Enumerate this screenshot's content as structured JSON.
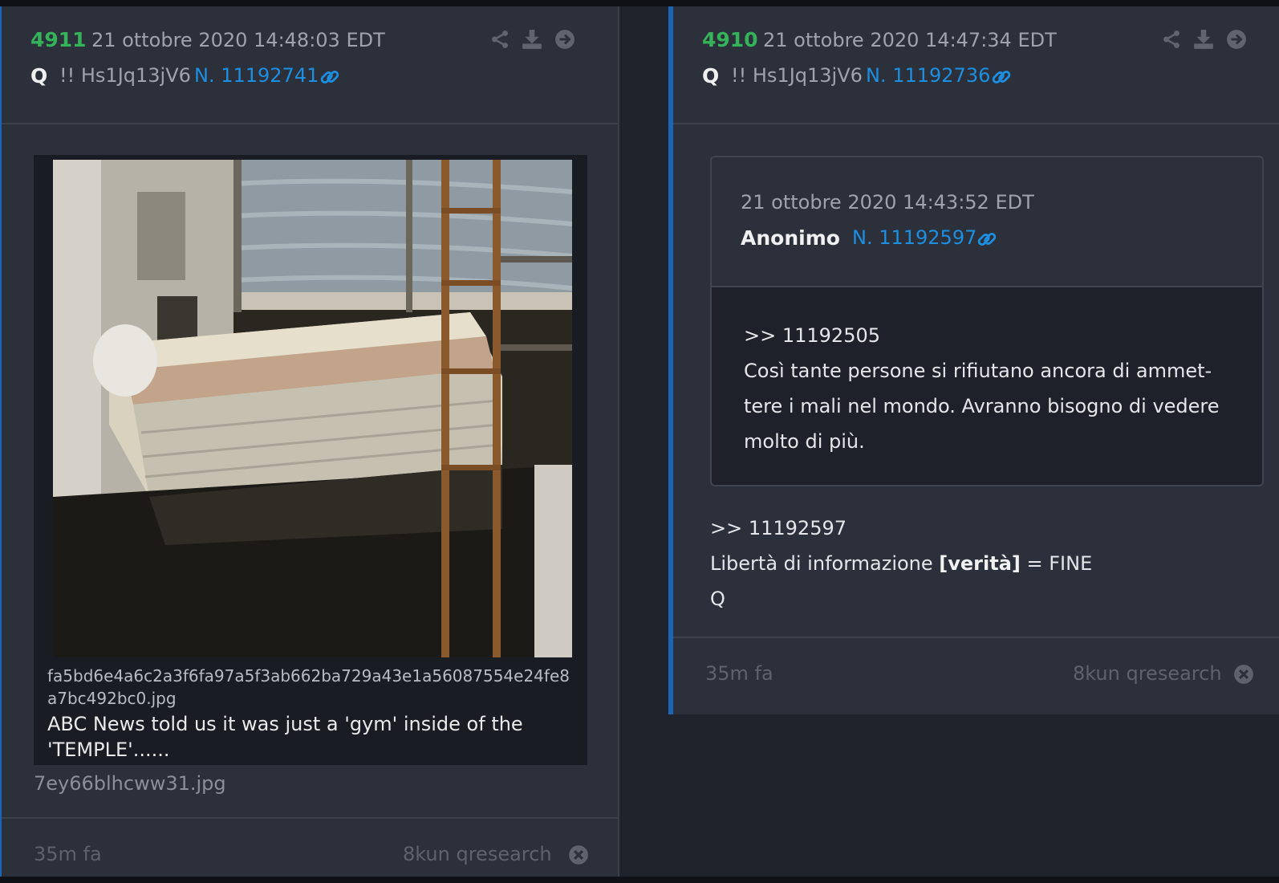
{
  "left_post": {
    "number": "4911",
    "date": "21 ottobre 2020 14:48:03 EDT",
    "author": "Q",
    "tripcode": "!! Hs1Jq13jV6",
    "ref": "N. 11192741",
    "image_hash_name": "fa5bd6e4a6c2a3f6fa97a5f3ab662ba729a43e1a56087554e24fe8a7bc492bc0.jpg",
    "image_caption": "ABC News told us it was just a 'gym' inside of the 'TEMPLE'......",
    "file_name": "7ey66blhcww31.jpg",
    "age": "35m fa",
    "board": "8kun qresearch"
  },
  "right_post": {
    "number": "4910",
    "date": "21 ottobre 2020 14:47:34 EDT",
    "author": "Q",
    "tripcode": "!! Hs1Jq13jV6",
    "ref": "N. 11192736",
    "quoted": {
      "date": "21 ottobre 2020 14:43:52 EDT",
      "author": "Anonimo",
      "ref": "N. 11192597",
      "reply_to": ">> 11192505",
      "lines": [
        "Così tante persone si rifiutano ancora di ammet-",
        "tere i mali nel mondo. Avranno bisogno di vedere",
        "molto di più."
      ]
    },
    "reply_to": ">> 11192597",
    "body_pre": "Libertà di informazione ",
    "body_bold": "[verità]",
    "body_post": " = FINE",
    "signature": "Q",
    "age": "35m fa",
    "board": "8kun qresearch"
  },
  "icons": [
    "share-icon",
    "download-icon",
    "arrow-right-circle-icon",
    "link-icon",
    "close-circle-icon"
  ],
  "colors": {
    "background": "#1f232c",
    "card": "#2b303a",
    "accent_blue": "#1b65b6",
    "post_number_green": "#36b25a",
    "link_blue": "#1e8fe0"
  }
}
